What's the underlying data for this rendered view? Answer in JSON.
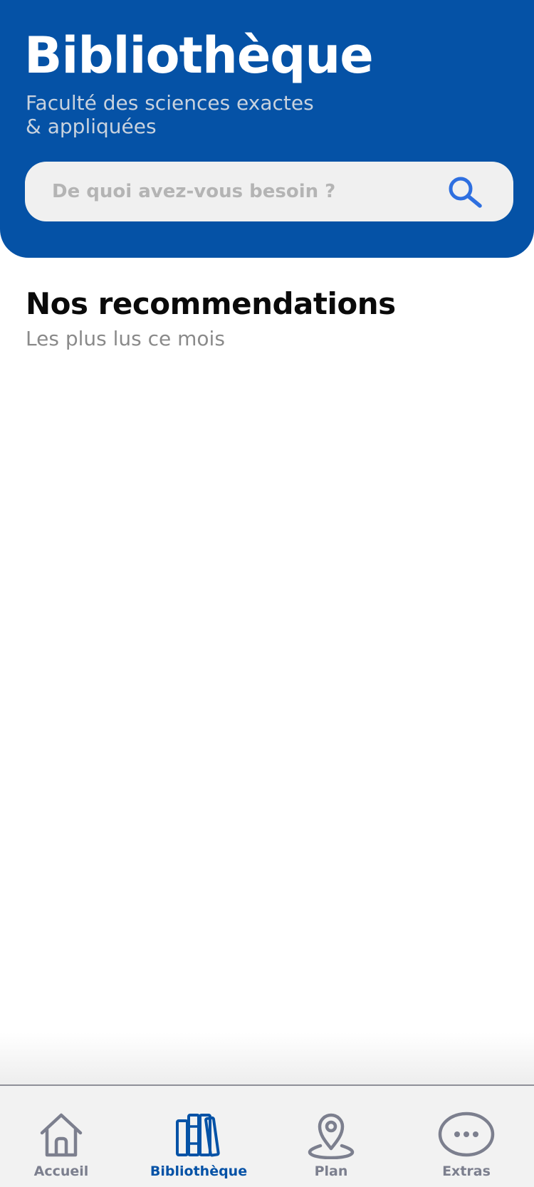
{
  "header": {
    "title": "Bibliothèque",
    "subtitle_line1": "Faculté des sciences exactes",
    "subtitle_line2": "& appliquées",
    "background_color": "#0552a6"
  },
  "search": {
    "placeholder": "De quoi avez-vous besoin ?",
    "value": "",
    "icon": "search-icon"
  },
  "recommendations": {
    "title": "Nos recommendations",
    "subtitle": "Les plus lus ce mois"
  },
  "bottom_nav": {
    "active_color": "#0552a6",
    "inactive_color": "#7c7f8e",
    "items": [
      {
        "label": "Accueil",
        "icon": "home-icon",
        "active": false
      },
      {
        "label": "Bibliothèque",
        "icon": "books-icon",
        "active": true
      },
      {
        "label": "Plan",
        "icon": "location-pin-icon",
        "active": false
      },
      {
        "label": "Extras",
        "icon": "more-icon",
        "active": false
      }
    ]
  }
}
